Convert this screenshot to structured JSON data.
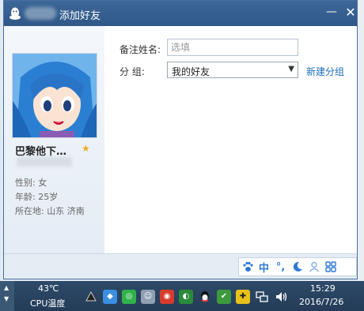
{
  "window": {
    "title": "添加好友",
    "minimize_glyph": "—",
    "close_glyph": "✕"
  },
  "profile": {
    "nickname": "巴黎他下…",
    "gender": "性别: 女",
    "age": "年龄: 25岁",
    "location": "所在地: 山东  济南"
  },
  "form": {
    "remark_label": "备注姓名:",
    "remark_value": "",
    "remark_placeholder": "选填",
    "group_label": "分    组:",
    "group_selected": "我的好友",
    "new_group_link": "新建分组"
  },
  "ime": {
    "buttons": [
      "paw-icon",
      "中",
      "°,",
      "moon-icon",
      "user-icon",
      "grid-icon"
    ],
    "zh_label": "中",
    "punct_label": "°,"
  },
  "taskbar": {
    "temperature": "43℃",
    "cpu_label": "CPU温度",
    "time": "15:29",
    "date": "2016/7/26"
  },
  "colors": {
    "titlebar": "#3d6797",
    "link": "#1f6fb8",
    "ime_blue": "#2d79d6",
    "star": "#e8b024"
  }
}
